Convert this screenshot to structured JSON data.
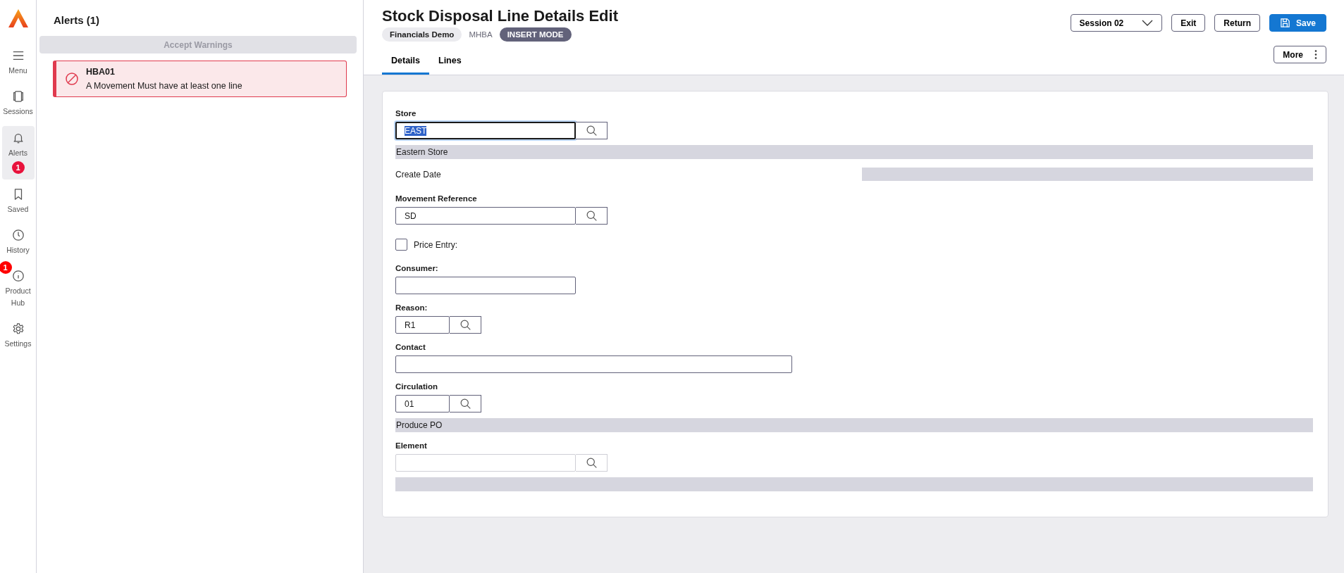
{
  "nav": [
    {
      "label": "Menu",
      "selected": false
    },
    {
      "label": "Sessions",
      "selected": false
    },
    {
      "label": "Alerts",
      "selected": true,
      "badge": "1"
    },
    {
      "label": "Saved",
      "selected": false
    },
    {
      "label": "History",
      "selected": false
    },
    {
      "label": "Product Hub",
      "selected": false,
      "badge": "1"
    },
    {
      "label": "Settings",
      "selected": false
    }
  ],
  "alerts_panel": {
    "title": "Alerts (1)",
    "accept_button": "Accept Warnings",
    "alerts": [
      {
        "code": "HBA01",
        "message": "A Movement Must have at least one line",
        "kind": "error"
      }
    ]
  },
  "header": {
    "title": "Stock Disposal Line Details Edit",
    "company": "Financials Demo",
    "user": "MHBA",
    "mode": "INSERT MODE",
    "session": "Session 02",
    "buttons": [
      {
        "label": "Exit",
        "kind": "outline"
      },
      {
        "label": "Return",
        "kind": "outline"
      },
      {
        "label": "Save",
        "kind": "primary"
      }
    ],
    "more": "More"
  },
  "tabs": [
    {
      "label": "Details",
      "selected": true
    },
    {
      "label": "Lines",
      "selected": false
    }
  ],
  "form": [
    {
      "kind": "lookup",
      "label": "Store",
      "value": "EAST",
      "focused": true,
      "disabled": false
    },
    {
      "kind": "band",
      "text": "Eastern Store"
    },
    {
      "kind": "date",
      "label": "Create Date"
    },
    {
      "kind": "lookup",
      "label": "Movement Reference",
      "value": "SD",
      "focused": false,
      "disabled": false
    },
    {
      "kind": "checkbox",
      "label": "Price Entry:",
      "checked": false
    },
    {
      "kind": "text",
      "label": "Consumer:",
      "focused": false,
      "disabled": false
    },
    {
      "kind": "lookup",
      "label": "Reason:",
      "value": "R1",
      "focused": false,
      "disabled": false
    },
    {
      "kind": "text",
      "label": "Contact",
      "focused": false,
      "disabled": false
    },
    {
      "kind": "lookup",
      "label": "Circulation",
      "value": "01",
      "focused": false,
      "disabled": false
    },
    {
      "kind": "band",
      "text": "Produce PO"
    },
    {
      "kind": "lookup",
      "label": "Element",
      "focused": false,
      "disabled": true
    },
    {
      "kind": "band"
    }
  ]
}
